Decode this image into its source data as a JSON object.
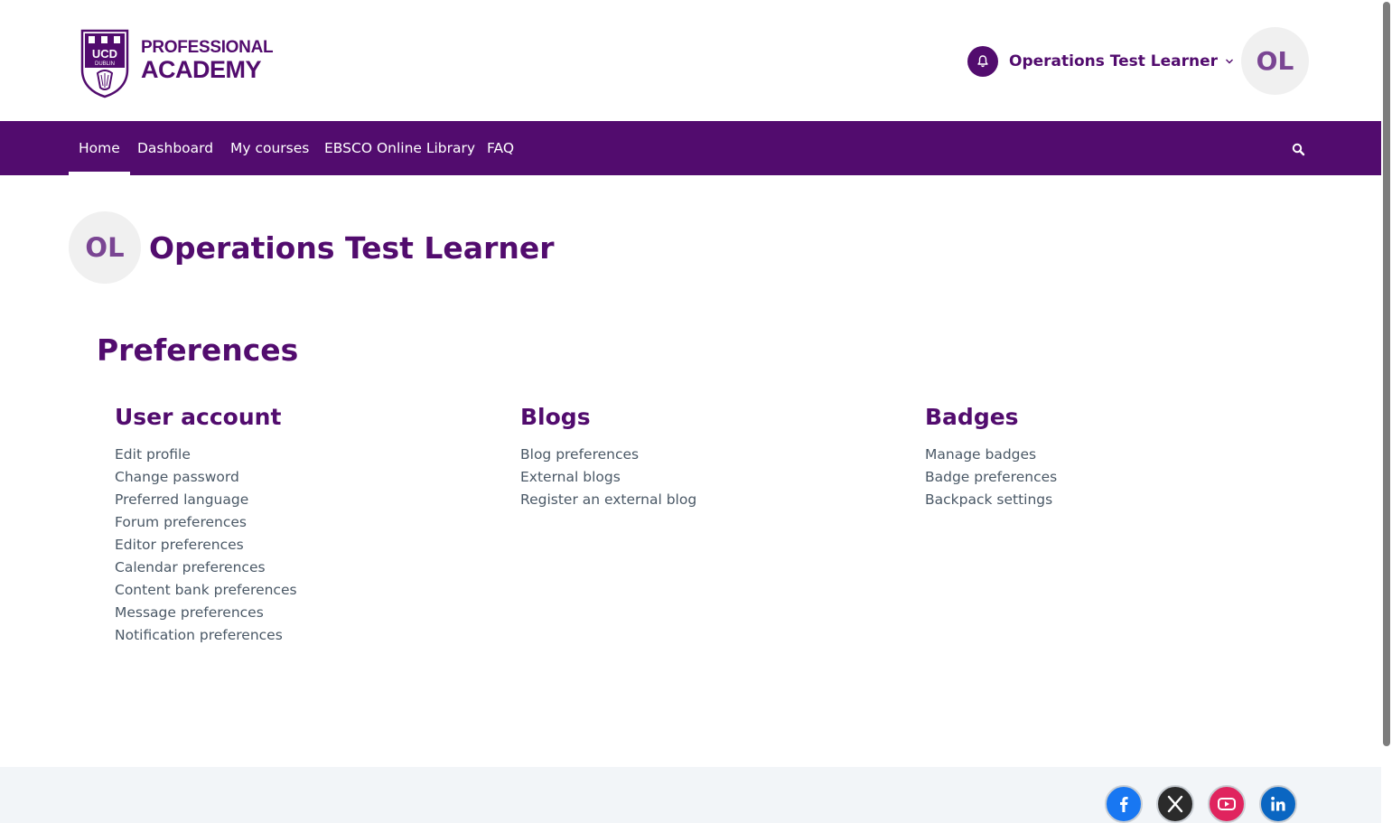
{
  "brand": {
    "line1": "PROFESSIONAL",
    "line2": "ACADEMY",
    "crest_top": "UCD",
    "crest_sub": "DUBLIN",
    "color": "#520c6e"
  },
  "header": {
    "notifications_icon": "bell-icon",
    "user_name": "Operations Test Learner",
    "initials": "OL",
    "dropdown_icon": "chevron-down-icon"
  },
  "nav": {
    "items": [
      {
        "label": "Home",
        "active": true
      },
      {
        "label": "Dashboard"
      },
      {
        "label": "My courses"
      },
      {
        "label": "EBSCO Online Library"
      },
      {
        "label": "FAQ"
      }
    ],
    "search_icon": "search-icon"
  },
  "profile": {
    "initials": "OL",
    "name": "Operations Test Learner"
  },
  "page": {
    "title": "Preferences"
  },
  "sections": [
    {
      "heading": "User account",
      "links": [
        "Edit profile",
        "Change password",
        "Preferred language",
        "Forum preferences",
        "Editor preferences",
        "Calendar preferences",
        "Content bank preferences",
        "Message preferences",
        "Notification preferences"
      ]
    },
    {
      "heading": "Blogs",
      "links": [
        "Blog preferences",
        "External blogs",
        "Register an external blog"
      ]
    },
    {
      "heading": "Badges",
      "links": [
        "Manage badges",
        "Badge preferences",
        "Backpack settings"
      ]
    }
  ],
  "footer": {
    "social": [
      {
        "icon": "facebook-icon",
        "color": "#1877f2"
      },
      {
        "icon": "x-icon",
        "color": "#2b2b2b"
      },
      {
        "icon": "youtube-icon",
        "color": "#e0245e"
      },
      {
        "icon": "linkedin-icon",
        "color": "#0a66c2"
      }
    ]
  },
  "colors": {
    "accent": "#520c6e",
    "link": "#4a5866",
    "avatar_bg": "#f0f0f0",
    "footer_bg": "#f2f5f8"
  }
}
